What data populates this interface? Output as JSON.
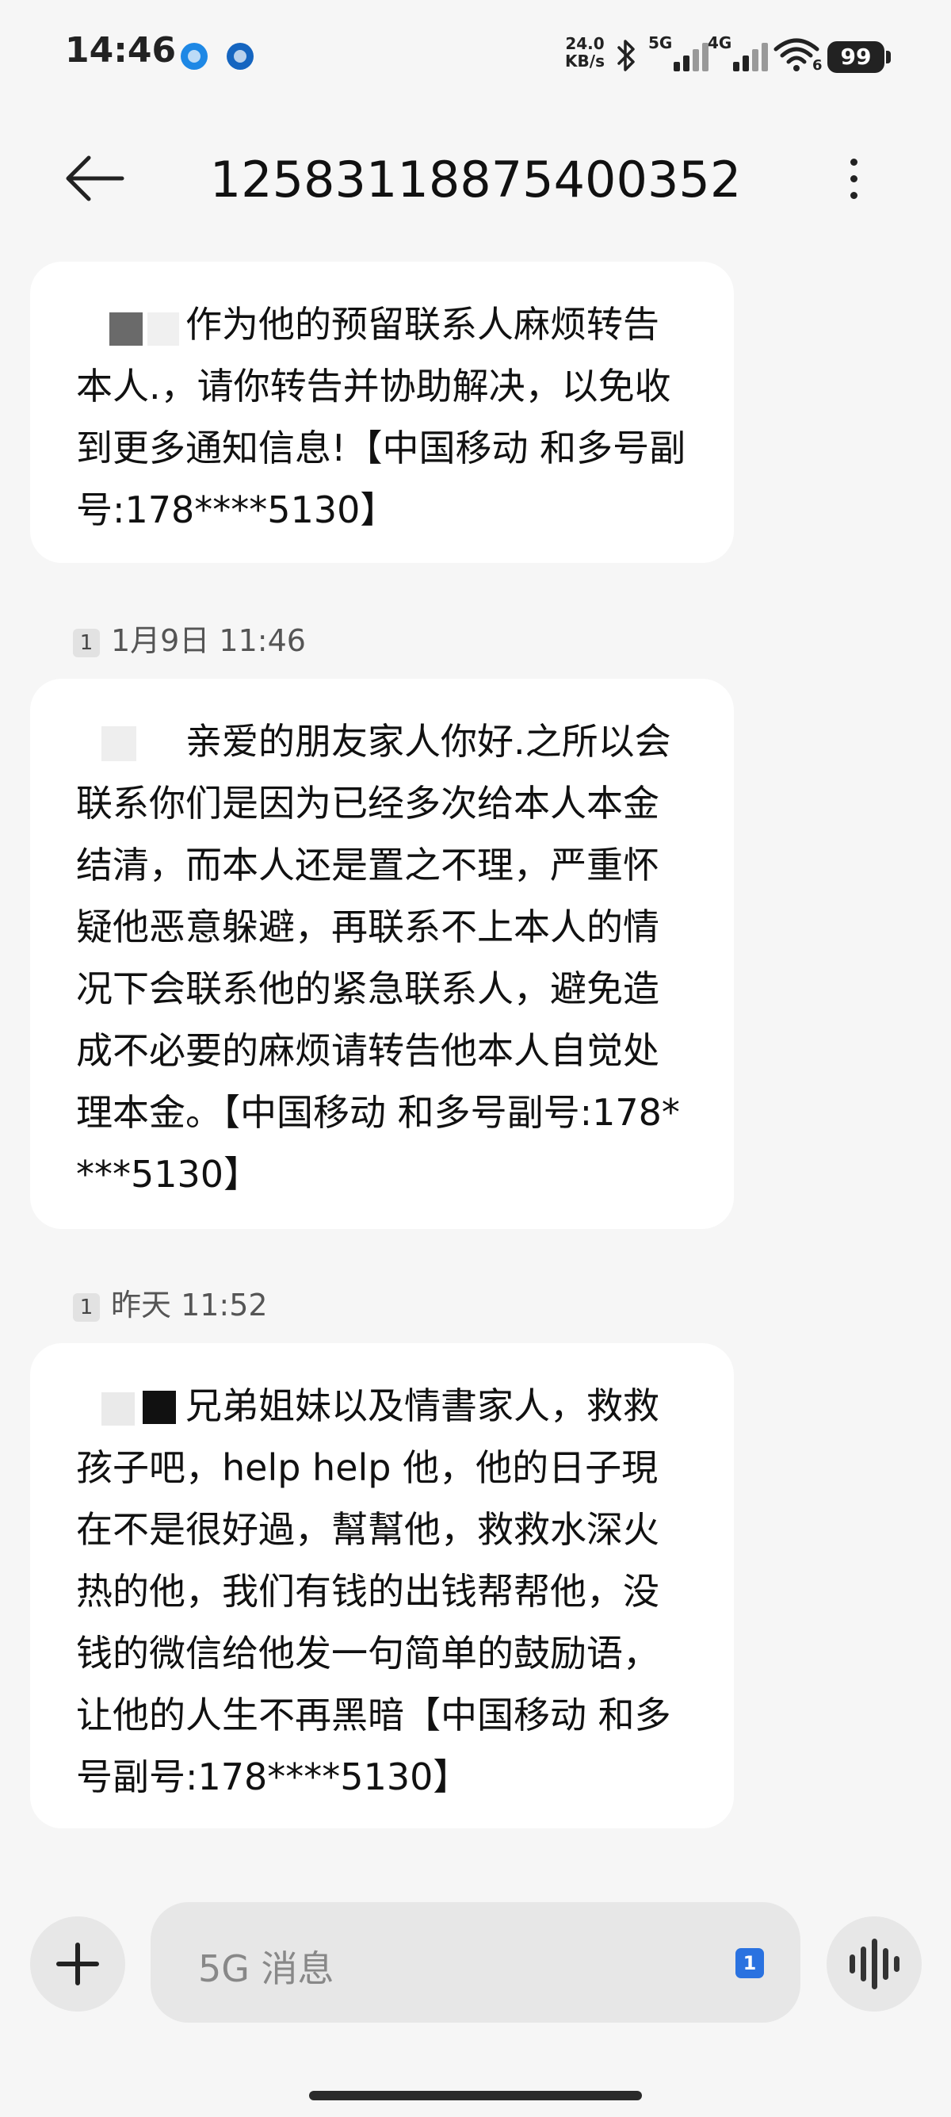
{
  "status_bar": {
    "time": "14:46",
    "net_speed_value": "24.0",
    "net_speed_unit": "KB/s",
    "signal1_label": "5G",
    "signal2_label": "4G",
    "wifi_sub": "6",
    "battery": "99"
  },
  "header": {
    "title": "12583118875400352"
  },
  "messages": [
    {
      "text": "作为他的预留联系人麻烦转告本人.，请你转告并协助解决，以免收到更多通知信息!【中国移动 和多号副号:178****5130】"
    },
    {
      "timestamp": "1月9日 11:46",
      "sim": "1",
      "text": "亲爱的朋友家人你好.之所以会联系你们是因为已经多次给本人本金结清，而本人还是置之不理，严重怀疑他恶意躲避，再联系不上本人的情况下会联系他的紧急联系人，避免造成不必要的麻烦请转告他本人自觉处理本金。【中国移动 和多号副号:178****5130】"
    },
    {
      "timestamp": "昨天 11:52",
      "sim": "1",
      "text": "兄弟姐妹以及情書家人，救救孩子吧，help help 他，他的日子現在不是很好過，幫幫他，救救水深火热的他，我们有钱的出钱帮帮他，没钱的微信给他发一句简单的鼓励语，让他的人生不再黑暗【中国移动 和多号副号:178****5130】"
    }
  ],
  "composer": {
    "placeholder": "5G 消息",
    "sim_selected": "1"
  },
  "icons": {
    "back": "arrow-left-icon",
    "more": "more-vertical-icon",
    "add": "plus-icon",
    "voice": "voice-wave-icon"
  }
}
